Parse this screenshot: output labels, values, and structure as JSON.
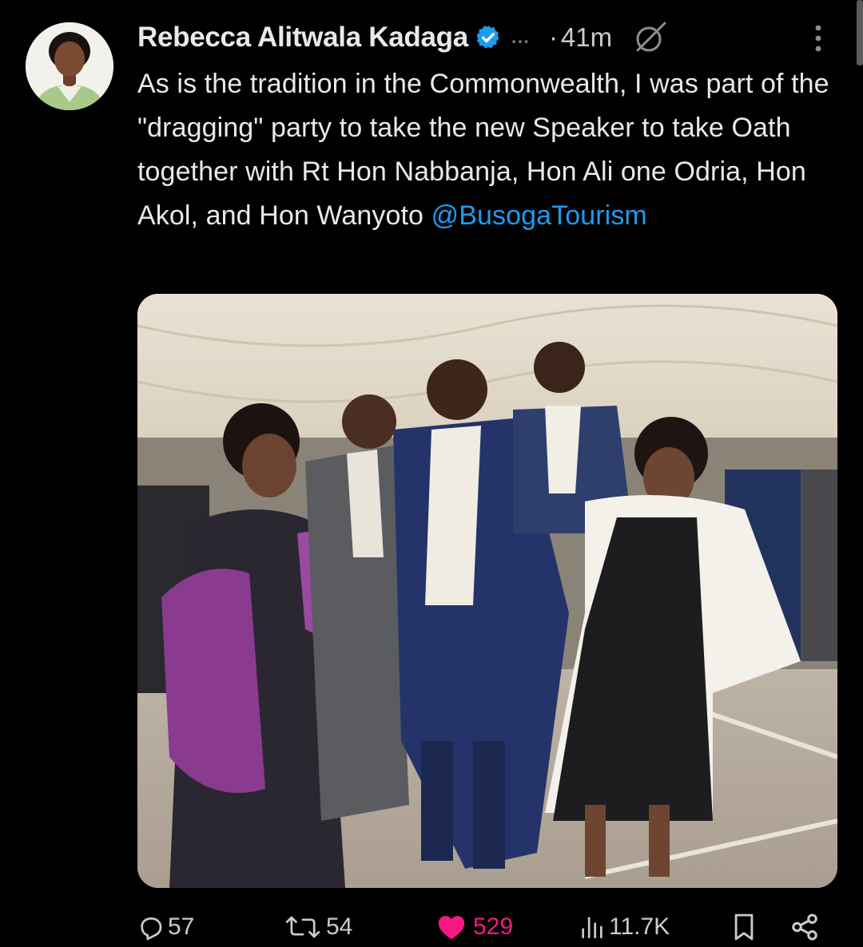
{
  "author": {
    "name": "Rebecca Alitwala Kadaga",
    "verified": true,
    "truncation": "...",
    "separator": "·",
    "time": "41m"
  },
  "tweet": {
    "text": "As is the tradition in the Commonwealth,  I was part of the \"dragging\" party to take the new Speaker to take Oath together with Rt Hon Nabbanja,  Hon Ali one Odria, Hon Akol,  and Hon Wanyoto ",
    "mention": "@BusogaTourism"
  },
  "icons": {
    "verified": "verified-badge-icon",
    "grok": "grok-icon",
    "more": "more-options-icon",
    "reply": "reply-icon",
    "repost": "repost-icon",
    "like": "heart-icon",
    "views": "views-chart-icon",
    "bookmark": "bookmark-icon",
    "share": "share-icon"
  },
  "actions": {
    "replies": "57",
    "reposts": "54",
    "likes": "529",
    "views": "11.7K"
  },
  "colors": {
    "background": "#000000",
    "text": "#e7e9ea",
    "muted": "#71767b",
    "link": "#1d9bf0",
    "like": "#f91880",
    "verified": "#1d9bf0"
  }
}
